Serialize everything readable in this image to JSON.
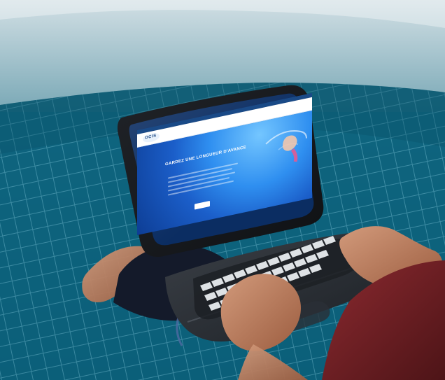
{
  "screen": {
    "topbar": [
      "",
      "",
      ""
    ],
    "logo_text": "OCIS",
    "nav_items": [
      "",
      "",
      "",
      "",
      ""
    ],
    "hero_title": "GARDEZ UNE LONGUEUR D'AVANCE",
    "cta_label": ""
  },
  "colors": {
    "pool": "#0b6c8b",
    "tile": "#0b5f79",
    "grout": "#6ab0c4",
    "laptop_body": "#2a2e33",
    "laptop_bezel": "#121418",
    "keys": "#e9edf0",
    "skin": "#b97b5d",
    "shirt": "#6c1d22",
    "site_blue": "#1b5ec9",
    "site_navy": "#0d3d94"
  }
}
